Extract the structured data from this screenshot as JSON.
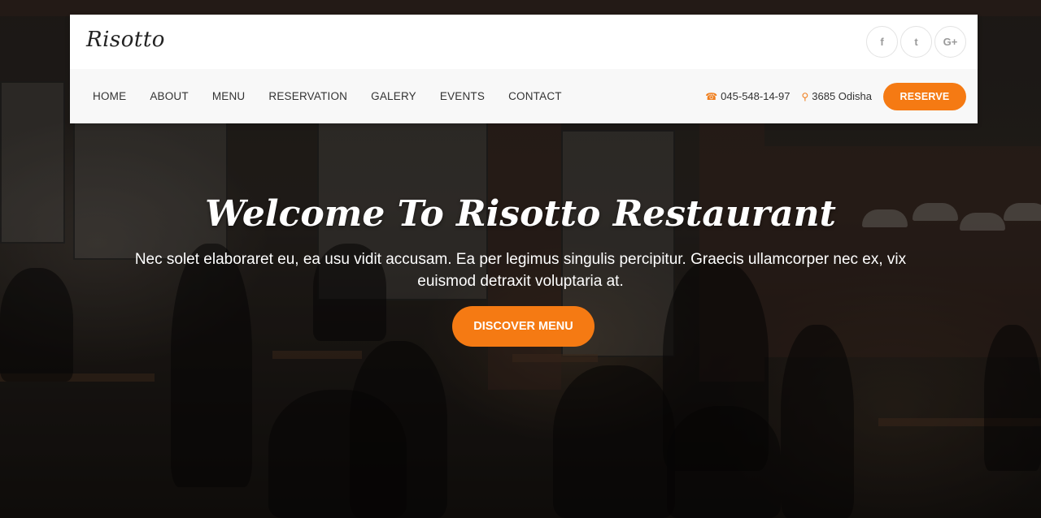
{
  "brand": {
    "logo": "Risotto"
  },
  "social": [
    {
      "icon": "facebook-icon",
      "glyph": "f"
    },
    {
      "icon": "twitter-icon",
      "glyph": "t"
    },
    {
      "icon": "google-plus-icon",
      "glyph": "G+"
    }
  ],
  "nav": {
    "items": [
      "HOME",
      "ABOUT",
      "MENU",
      "RESERVATION",
      "GALERY",
      "EVENTS",
      "CONTACT"
    ]
  },
  "contact": {
    "phone_icon": "phone-icon",
    "phone": "045-548-14-97",
    "location_icon": "map-marker-icon",
    "location": "3685 Odisha"
  },
  "reserve_label": "RESERVE",
  "hero": {
    "title": "Welcome To Risotto Restaurant",
    "subtitle": "Nec solet elaboraret eu, ea usu vidit accusam. Ea per legimus singulis percipitur. Graecis ullamcorper nec ex, vix euismod detraxit voluptaria at.",
    "button_label": "DISCOVER MENU"
  },
  "colors": {
    "accent": "#f57a13",
    "nav_bg": "#f8f8f8"
  }
}
